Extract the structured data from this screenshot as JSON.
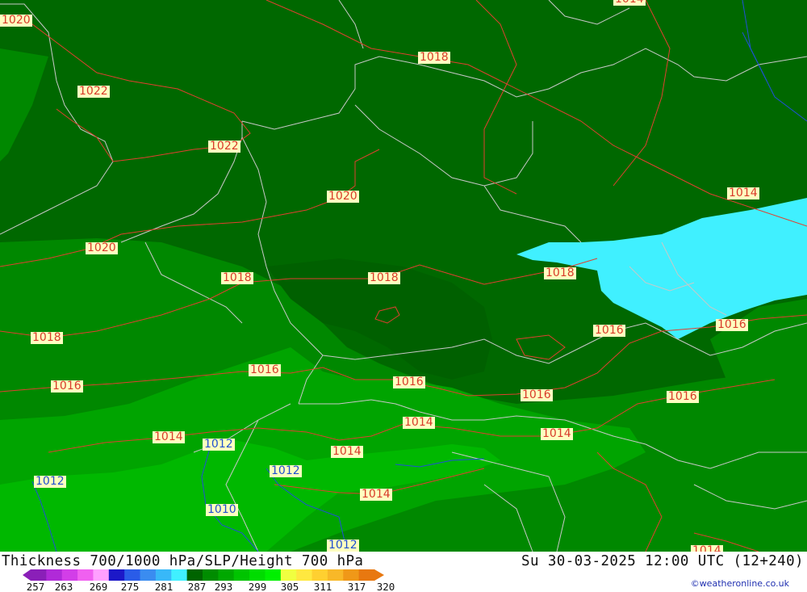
{
  "title": "Thickness 700/1000 hPa/SLP/Height 700 hPa",
  "datetime": "Su 30-03-2025 12:00 UTC (12+240)",
  "credit": "©weatheronline.co.uk",
  "legend": {
    "ticks": [
      "257",
      "263",
      "269",
      "275",
      "281",
      "287",
      "293",
      "299",
      "305",
      "311",
      "317",
      "320"
    ],
    "colors": [
      "#8a1fb8",
      "#b02ad8",
      "#d23ee8",
      "#f060f0",
      "#ffa0ff",
      "#1c18c8",
      "#2a5ce8",
      "#3a8cf0",
      "#38b8f8",
      "#40f0ff",
      "#006400",
      "#008c00",
      "#00a800",
      "#00c400",
      "#00dc00",
      "#00f000",
      "#f0ff40",
      "#ffe840",
      "#ffd030",
      "#f8b828",
      "#f09818",
      "#e87810"
    ]
  },
  "colors": {
    "land_dark": "#006800",
    "land_mid": "#008800",
    "land_light": "#00a400",
    "land_bright": "#00b800",
    "cold_pool": "#40f0ff",
    "isobar": "#e04030",
    "height_contour": "#2050d8",
    "coastline": "#c8c8c8"
  },
  "isobar_labels": [
    {
      "text": "1020",
      "tone": "red"
    },
    {
      "text": "1014",
      "tone": "red"
    },
    {
      "text": "1018",
      "tone": "red"
    },
    {
      "text": "1022",
      "tone": "red"
    },
    {
      "text": "1022",
      "tone": "red"
    },
    {
      "text": "1020",
      "tone": "red"
    },
    {
      "text": "1014",
      "tone": "red"
    },
    {
      "text": "1020",
      "tone": "red"
    },
    {
      "text": "1018",
      "tone": "red"
    },
    {
      "text": "1018",
      "tone": "red"
    },
    {
      "text": "1018",
      "tone": "red"
    },
    {
      "text": "1018",
      "tone": "red"
    },
    {
      "text": "1016",
      "tone": "red"
    },
    {
      "text": "1016",
      "tone": "red"
    },
    {
      "text": "1016",
      "tone": "red"
    },
    {
      "text": "1016",
      "tone": "red"
    },
    {
      "text": "1016",
      "tone": "red"
    },
    {
      "text": "1016",
      "tone": "red"
    },
    {
      "text": "1014",
      "tone": "red"
    },
    {
      "text": "1014",
      "tone": "red"
    },
    {
      "text": "1014",
      "tone": "red"
    },
    {
      "text": "1014",
      "tone": "red"
    },
    {
      "text": "1014",
      "tone": "red"
    },
    {
      "text": "1014",
      "tone": "red"
    },
    {
      "text": "1012",
      "tone": "blue"
    },
    {
      "text": "1012",
      "tone": "blue"
    },
    {
      "text": "1012",
      "tone": "blue"
    },
    {
      "text": "1010",
      "tone": "blue"
    },
    {
      "text": "1012",
      "tone": "blue"
    }
  ]
}
